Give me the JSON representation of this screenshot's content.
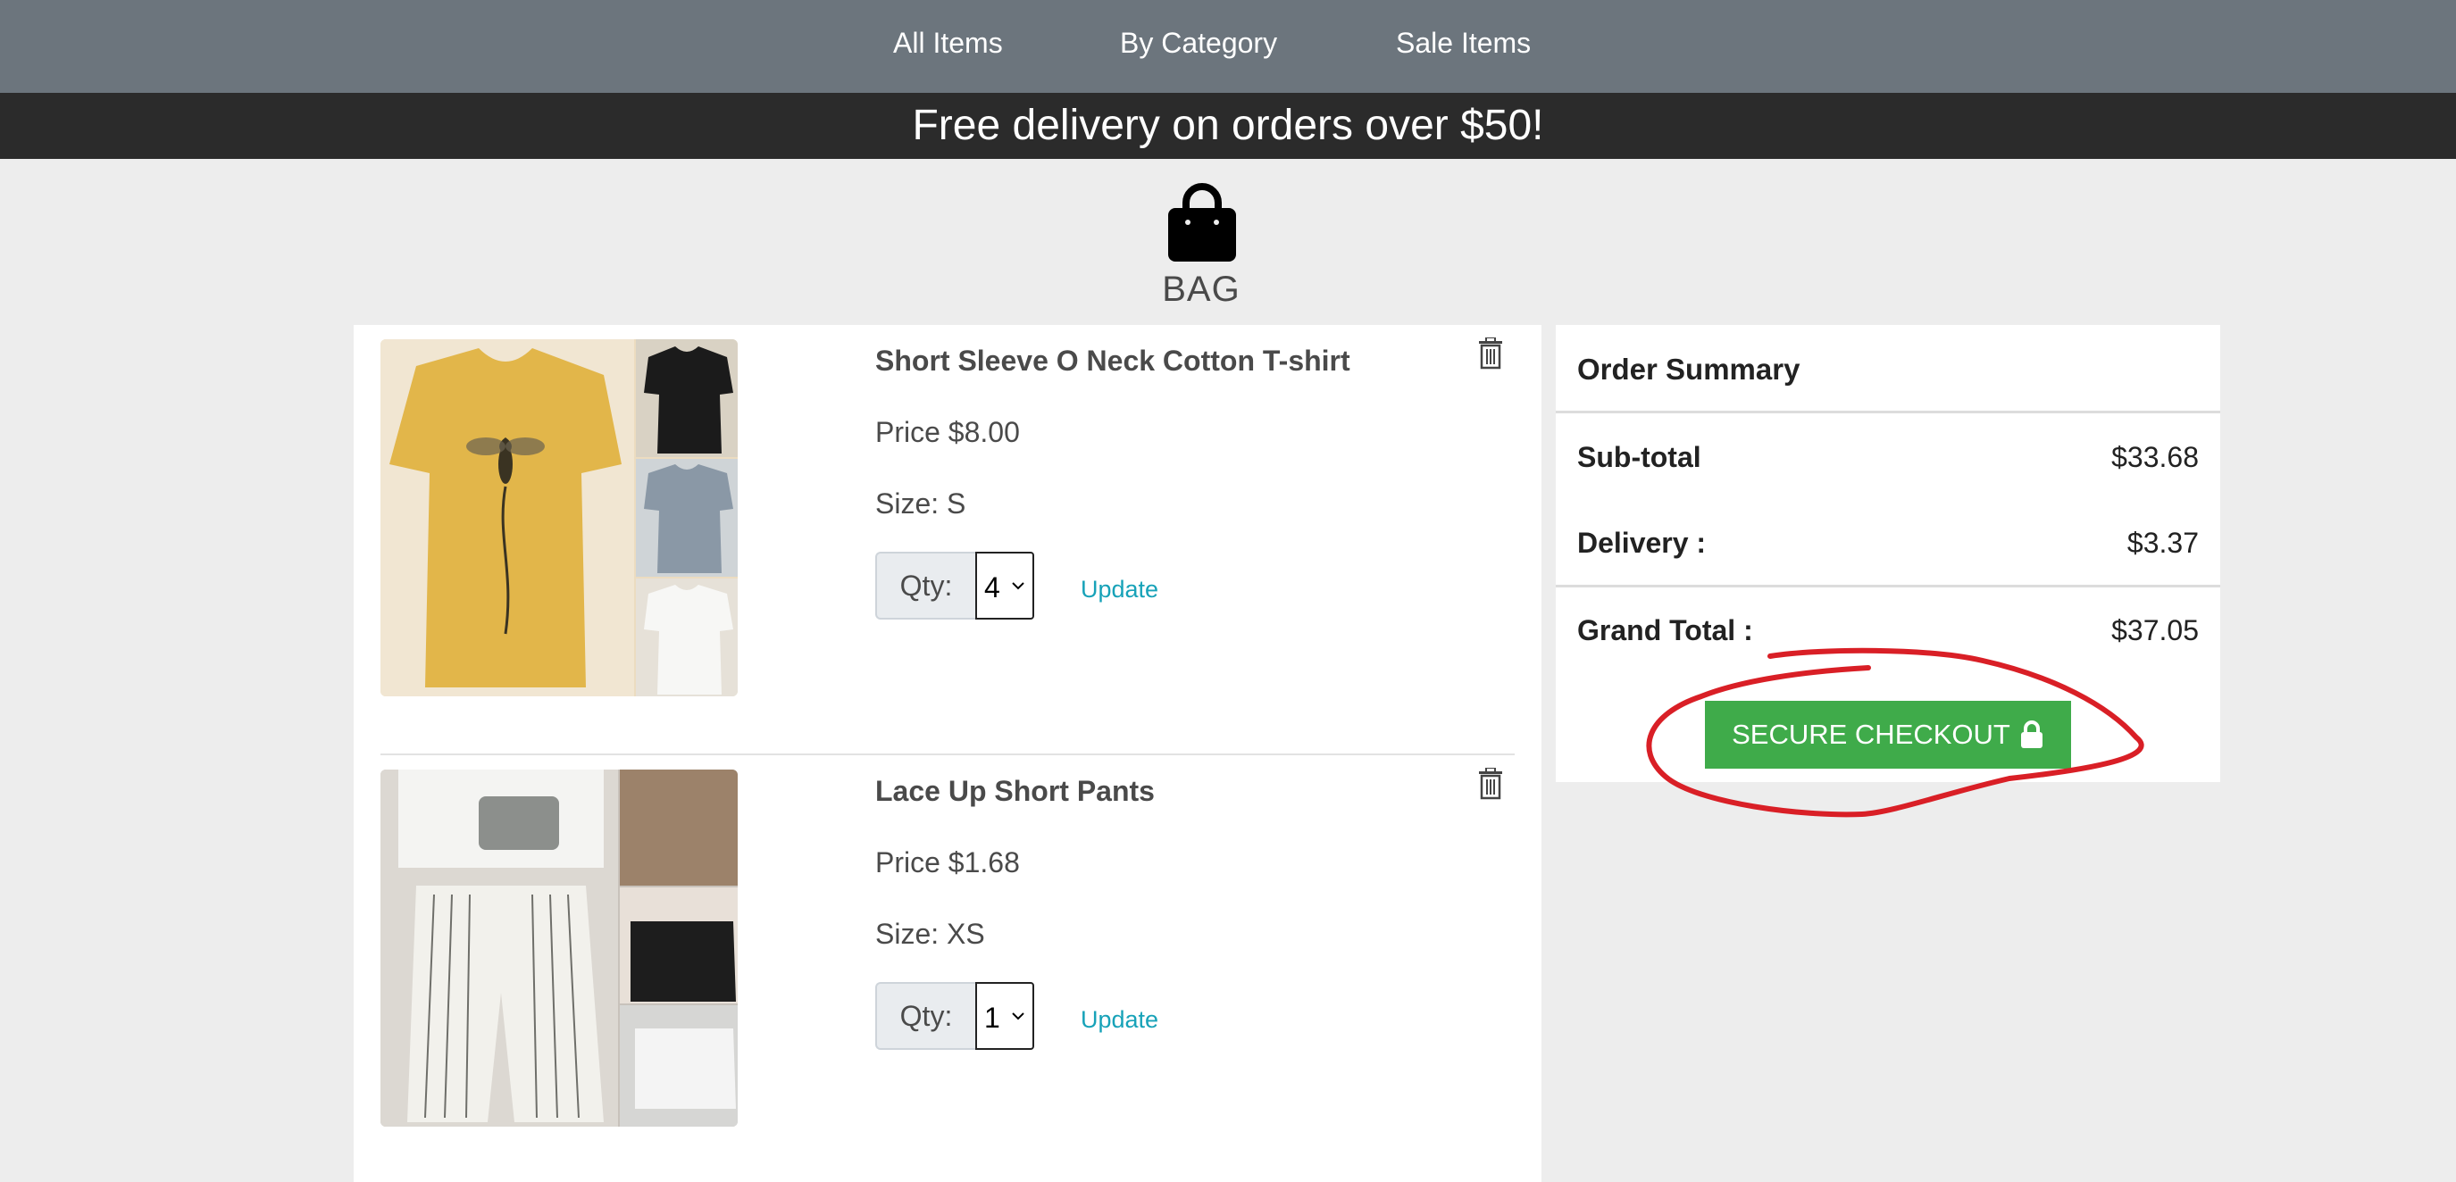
{
  "nav": {
    "items": [
      "All Items",
      "By Category",
      "Sale Items"
    ]
  },
  "promo": {
    "text": "Free delivery on orders over $50!"
  },
  "bag": {
    "label": "BAG",
    "icon": "shopping-bag-icon"
  },
  "cart": {
    "items": [
      {
        "name": "Short Sleeve O Neck Cotton T-shirt",
        "price": "Price $8.00",
        "size": "Size: S",
        "qty_label": "Qty:",
        "qty_value": "4",
        "update_label": "Update",
        "image": "yellow bee t-shirt photo"
      },
      {
        "name": "Lace Up Short Pants",
        "price": "Price $1.68",
        "size": "Size: XS",
        "qty_label": "Qty:",
        "qty_value": "1",
        "update_label": "Update",
        "image": "striped paperbag shorts photo"
      }
    ]
  },
  "summary": {
    "title": "Order Summary",
    "subtotal_label": "Sub-total",
    "subtotal_value": "$33.68",
    "delivery_label": "Delivery :",
    "delivery_value": "$3.37",
    "grand_label": "Grand Total :",
    "grand_value": "$37.05",
    "checkout_label": "SECURE CHECKOUT"
  },
  "colors": {
    "nav_bg": "#6c757d",
    "promo_bg": "#2b2b2b",
    "accent_link": "#17a2b8",
    "checkout_bg": "#3fab4a",
    "annotation": "#d91f26"
  }
}
